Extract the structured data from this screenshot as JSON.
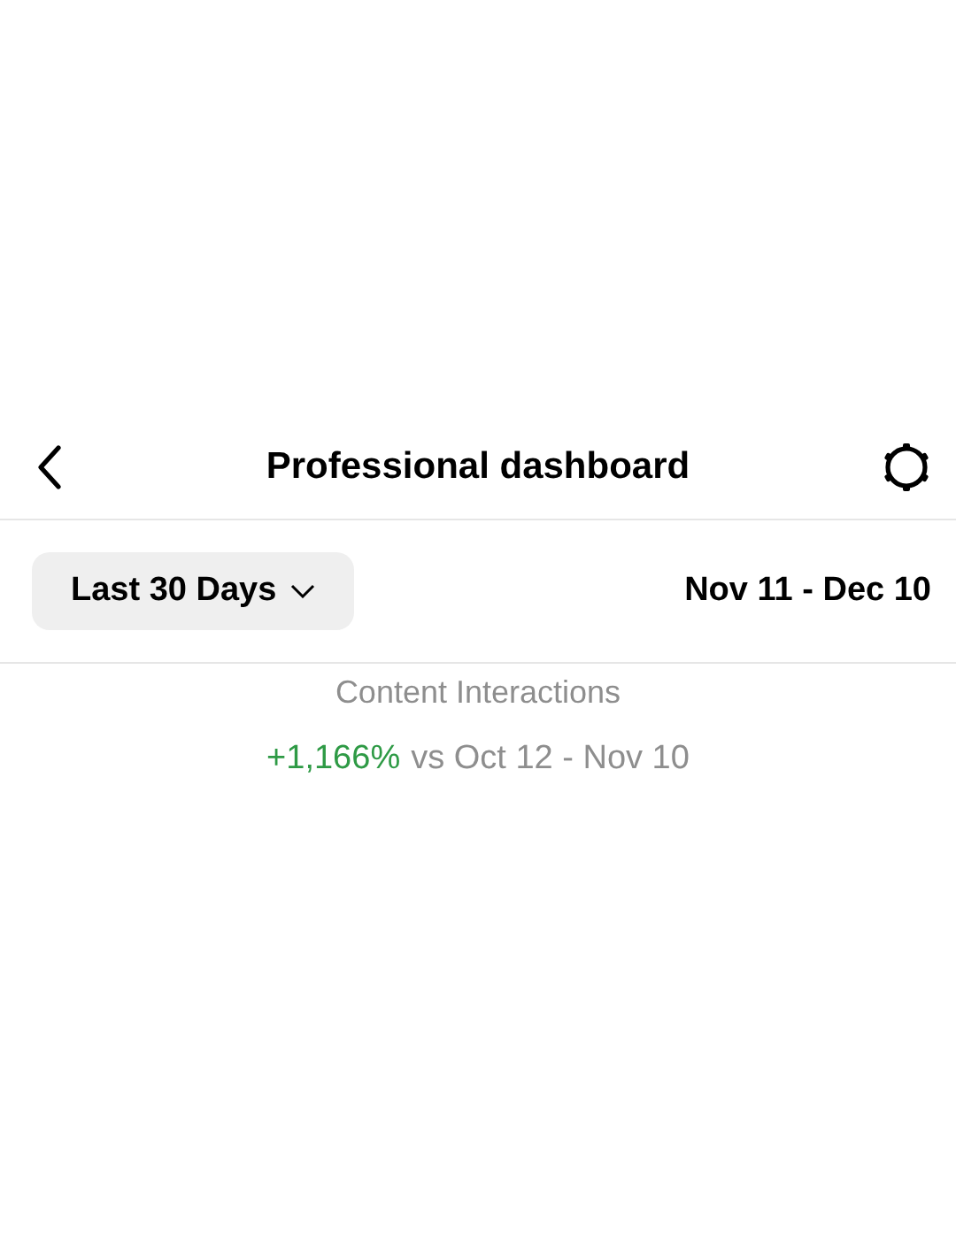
{
  "header": {
    "title": "Professional dashboard"
  },
  "filter": {
    "range_label": "Last 30 Days",
    "date_range": "Nov 11 - Dec 10"
  },
  "metric": {
    "title": "Content Interactions",
    "change": "+1,166%",
    "comparison": "vs Oct 12 - Nov 10"
  }
}
